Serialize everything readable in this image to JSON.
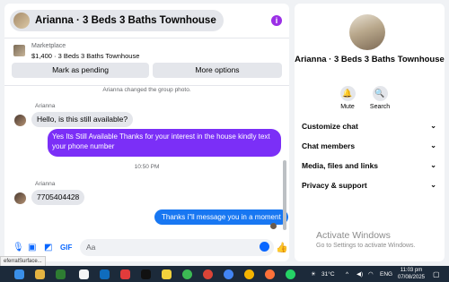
{
  "chat": {
    "title": "Arianna · 3 Beds 3 Baths Townhouse",
    "marketplace_label": "Marketplace",
    "listing": "$1,400 · 3 Beds 3 Baths Townhouse",
    "mark_pending_label": "Mark as pending",
    "more_options_label": "More options",
    "system_message": "Arianna changed the group photo.",
    "messages": [
      {
        "sender": "Arianna",
        "text": "Hello, is this still available?"
      },
      {
        "text": "Yes Its Still Available Thanks for your interest in the house kindly text your phone number"
      },
      {
        "timestamp": "10:50 PM"
      },
      {
        "sender": "Arianna",
        "text": "7705404428"
      },
      {
        "text": "Thanks i\"ll message you in a moment"
      }
    ],
    "composer_placeholder": "Aa"
  },
  "side": {
    "name": "Arianna · 3 Beds 3 Baths Townhouse",
    "actions": [
      {
        "label": "Mute"
      },
      {
        "label": "Search"
      }
    ],
    "sections": [
      "Customize chat",
      "Chat members",
      "Media, files and links",
      "Privacy & support"
    ]
  },
  "watermark": {
    "line1": "Activate Windows",
    "line2": "Go to Settings to activate Windows."
  },
  "taskbar": {
    "tooltip": "eferralSurface...",
    "temperature": "31°C",
    "language": "ENG",
    "time": "11:03 pm",
    "date": "07/08/2025"
  },
  "colors": {
    "accent": "#0866ff",
    "outgoing_bubble": "#7b2ff7",
    "taskbar": "#1c2a3a"
  }
}
